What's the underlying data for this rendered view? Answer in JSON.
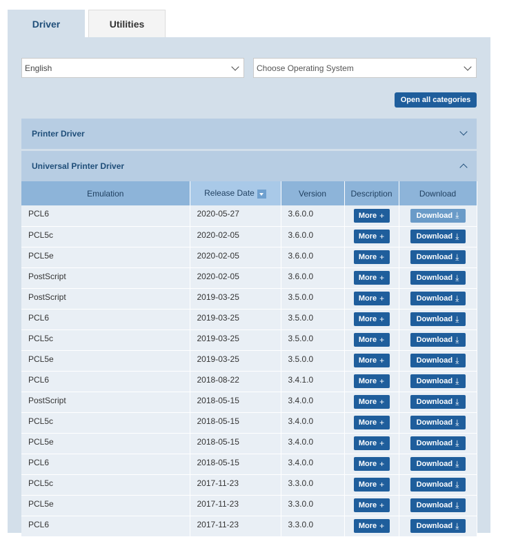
{
  "tabs": [
    {
      "label": "Driver",
      "active": true
    },
    {
      "label": "Utilities",
      "active": false
    }
  ],
  "filters": {
    "language": "English",
    "os_placeholder": "Choose Operating System"
  },
  "open_all_label": "Open all categories",
  "categories": [
    {
      "label": "Printer Driver",
      "expanded": false
    },
    {
      "label": "Universal Printer Driver",
      "expanded": true
    }
  ],
  "table": {
    "headers": [
      "Emulation",
      "Release Date",
      "Version",
      "Description",
      "Download"
    ],
    "more_label": "More",
    "download_label": "Download",
    "rows": [
      {
        "emulation": "PCL6",
        "date": "2020-05-27",
        "version": "3.6.0.0"
      },
      {
        "emulation": "PCL5c",
        "date": "2020-02-05",
        "version": "3.6.0.0"
      },
      {
        "emulation": "PCL5e",
        "date": "2020-02-05",
        "version": "3.6.0.0"
      },
      {
        "emulation": "PostScript",
        "date": "2020-02-05",
        "version": "3.6.0.0"
      },
      {
        "emulation": "PostScript",
        "date": "2019-03-25",
        "version": "3.5.0.0"
      },
      {
        "emulation": "PCL6",
        "date": "2019-03-25",
        "version": "3.5.0.0"
      },
      {
        "emulation": "PCL5c",
        "date": "2019-03-25",
        "version": "3.5.0.0"
      },
      {
        "emulation": "PCL5e",
        "date": "2019-03-25",
        "version": "3.5.0.0"
      },
      {
        "emulation": "PCL6",
        "date": "2018-08-22",
        "version": "3.4.1.0"
      },
      {
        "emulation": "PostScript",
        "date": "2018-05-15",
        "version": "3.4.0.0"
      },
      {
        "emulation": "PCL5c",
        "date": "2018-05-15",
        "version": "3.4.0.0"
      },
      {
        "emulation": "PCL5e",
        "date": "2018-05-15",
        "version": "3.4.0.0"
      },
      {
        "emulation": "PCL6",
        "date": "2018-05-15",
        "version": "3.4.0.0"
      },
      {
        "emulation": "PCL5c",
        "date": "2017-11-23",
        "version": "3.3.0.0"
      },
      {
        "emulation": "PCL5e",
        "date": "2017-11-23",
        "version": "3.3.0.0"
      },
      {
        "emulation": "PCL6",
        "date": "2017-11-23",
        "version": "3.3.0.0"
      }
    ]
  },
  "colors": {
    "accent": "#1f5e9c",
    "panel": "#d3dfea",
    "header": "#8db4d9"
  }
}
